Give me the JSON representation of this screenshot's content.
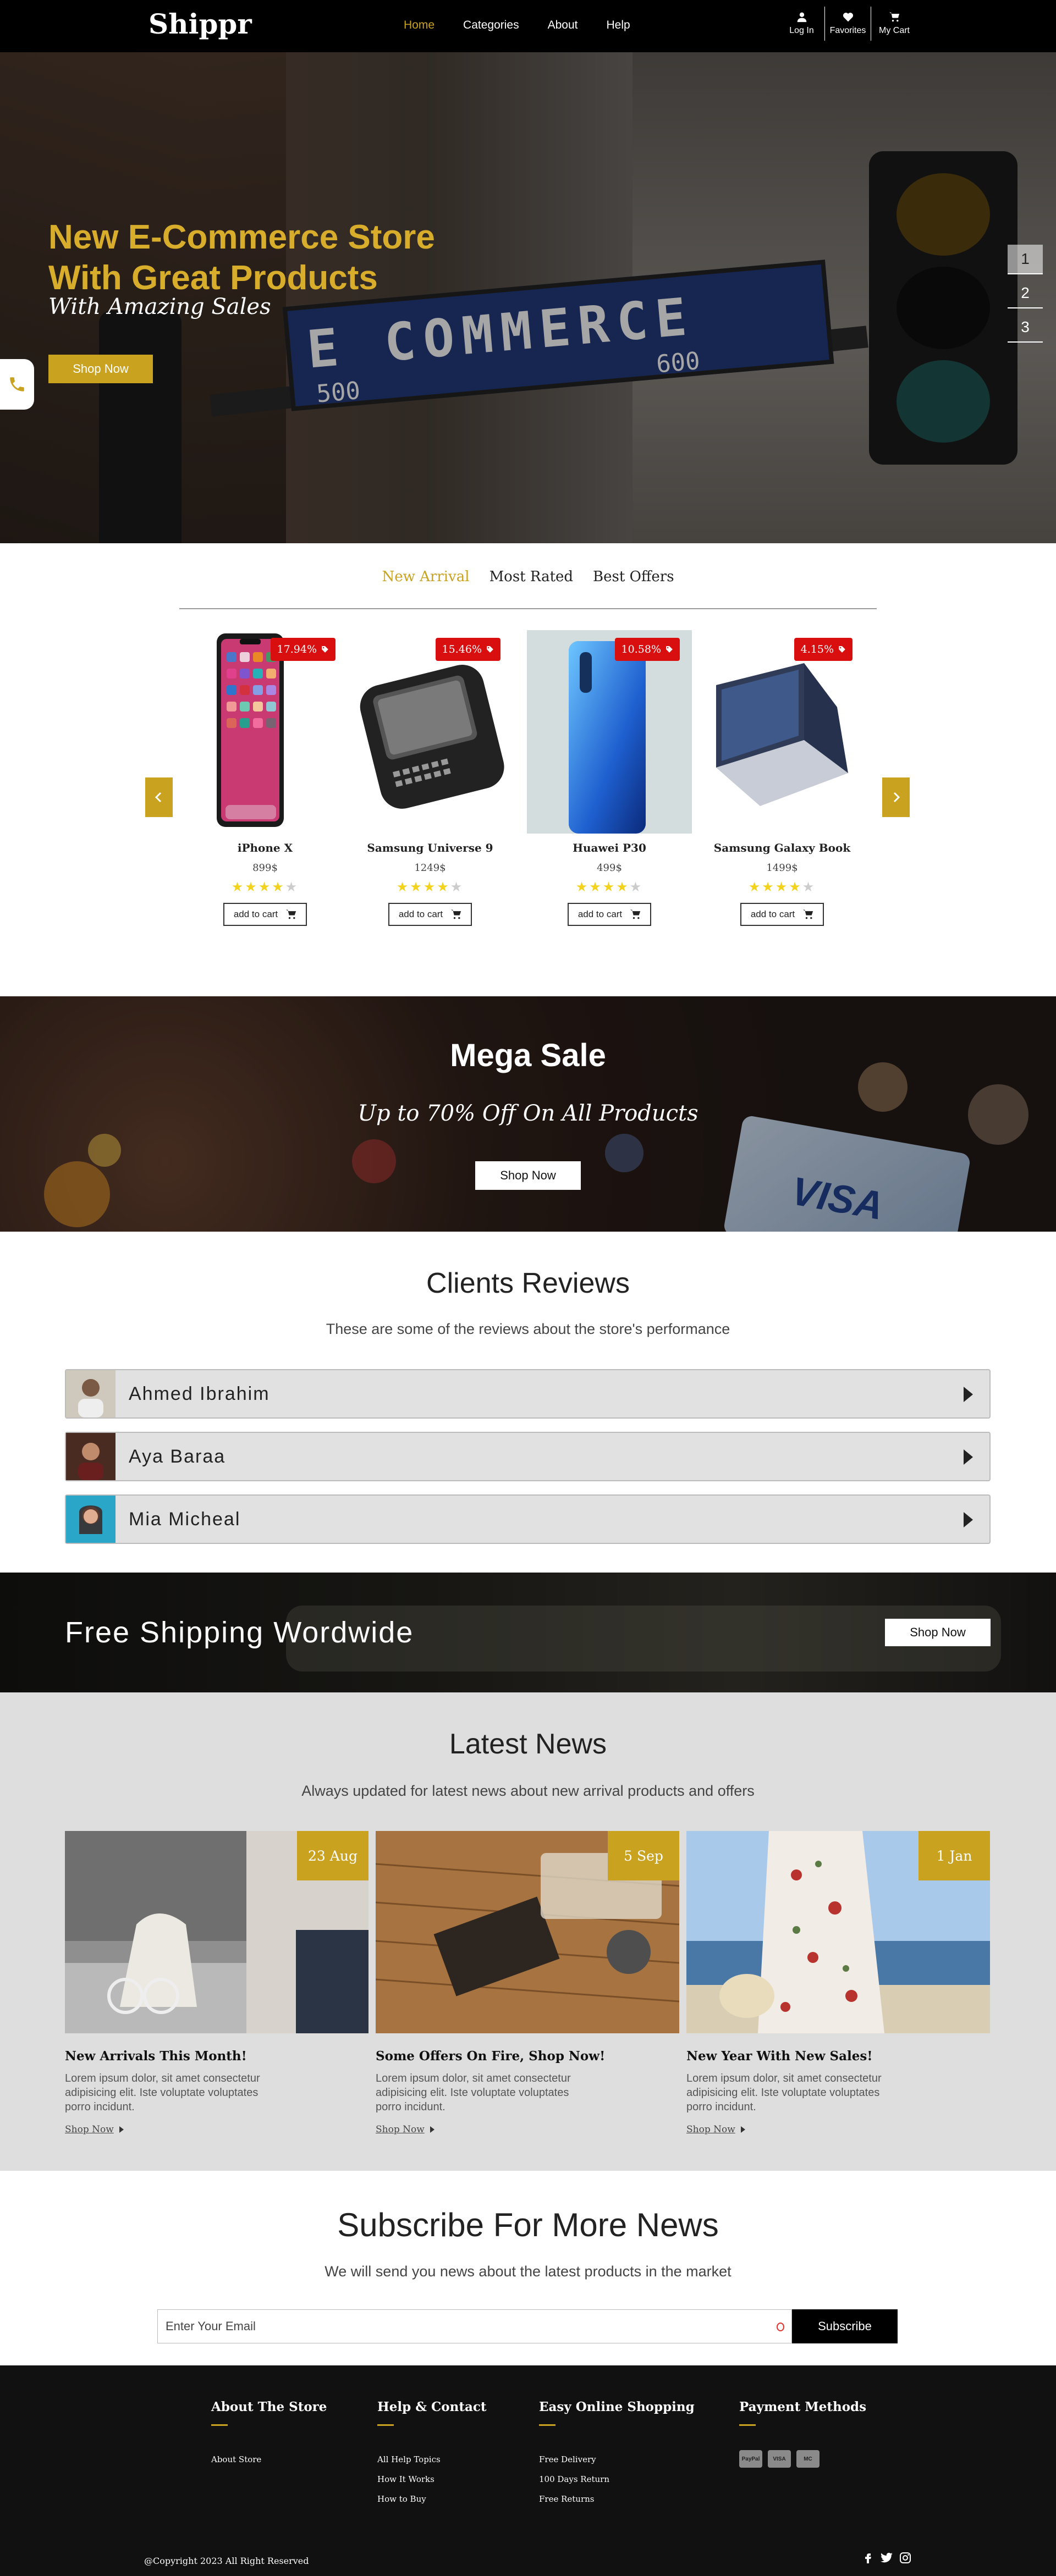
{
  "brand": "Shippr",
  "nav": {
    "links": [
      {
        "label": "Home",
        "active": true
      },
      {
        "label": "Categories",
        "active": false
      },
      {
        "label": "About",
        "active": false
      },
      {
        "label": "Help",
        "active": false
      }
    ],
    "icons": [
      {
        "label": "Log In",
        "icon": "user-icon"
      },
      {
        "label": "Favorites",
        "icon": "heart-icon"
      },
      {
        "label": "My Cart",
        "icon": "cart-icon"
      }
    ]
  },
  "hero": {
    "title_line1": "New E-Commerce Store",
    "title_line2": "With Great Products",
    "subtitle": "With Amazing Sales",
    "button": "Shop Now",
    "sign_text": "E COMMERCE",
    "sign_num1": "500",
    "sign_num2": "600",
    "slides": [
      "1",
      "2",
      "3"
    ],
    "active_slide": 1
  },
  "products": {
    "tabs": [
      "New Arrival",
      "Most Rated",
      "Best Offers"
    ],
    "active_tab": 0,
    "items": [
      {
        "name": "iPhone X",
        "price": "899$",
        "discount": "17.94%",
        "rating": 4,
        "add_label": "add to cart"
      },
      {
        "name": "Samsung Universe 9",
        "price": "1249$",
        "discount": "15.46%",
        "rating": 4,
        "add_label": "add to cart"
      },
      {
        "name": "Huawei P30",
        "price": "499$",
        "discount": "10.58%",
        "rating": 4,
        "add_label": "add to cart"
      },
      {
        "name": "Samsung Galaxy Book",
        "price": "1499$",
        "discount": "4.15%",
        "rating": 4,
        "add_label": "add to cart"
      }
    ]
  },
  "mega": {
    "title": "Mega Sale",
    "subtitle": "Up to 70% Off On All Products",
    "button": "Shop Now",
    "card_text": "VISA"
  },
  "reviews": {
    "title": "Clients Reviews",
    "subtitle": "These are some of the reviews about the store's performance",
    "items": [
      {
        "name": "Ahmed Ibrahim"
      },
      {
        "name": "Aya Baraa"
      },
      {
        "name": "Mia Micheal"
      }
    ]
  },
  "shipping": {
    "title": "Free Shipping Wordwide",
    "button": "Shop Now"
  },
  "news": {
    "title": "Latest News",
    "subtitle": "Always updated for latest news about new arrival products and offers",
    "items": [
      {
        "date": "23 Aug",
        "title": "New Arrivals This Month!",
        "desc": "Lorem ipsum dolor, sit amet consectetur adipisicing elit. Iste voluptate voluptates porro incidunt.",
        "more": "Shop Now"
      },
      {
        "date": "5 Sep",
        "title": "Some Offers On Fire, Shop Now!",
        "desc": "Lorem ipsum dolor, sit amet consectetur adipisicing elit. Iste voluptate voluptates porro incidunt.",
        "more": "Shop Now"
      },
      {
        "date": "1 Jan",
        "title": "New Year With New Sales!",
        "desc": "Lorem ipsum dolor, sit amet consectetur adipisicing elit. Iste voluptate voluptates porro incidunt.",
        "more": "Shop Now"
      }
    ]
  },
  "subscribe": {
    "title": "Subscribe For More News",
    "subtitle": "We will send you news about the latest products in the market",
    "placeholder": "Enter Your Email",
    "button": "Subscribe"
  },
  "footer": {
    "columns": [
      {
        "title": "About The Store",
        "links": [
          "About Store"
        ]
      },
      {
        "title": "Help & Contact",
        "links": [
          "All Help Topics",
          "How It Works",
          "How to Buy"
        ]
      },
      {
        "title": "Easy Online Shopping",
        "links": [
          "Free Delivery",
          "100 Days Return",
          "Free Returns"
        ]
      },
      {
        "title": "Payment Methods",
        "links": []
      }
    ],
    "payment_icons": [
      "PayPal",
      "VISA",
      "MC"
    ],
    "copyright": "@Copyright 2023 All Right Reserved",
    "socials": [
      "facebook-icon",
      "twitter-icon",
      "instagram-icon"
    ]
  },
  "colors": {
    "accent": "#c9a21f",
    "badge": "#d90e0e",
    "navbar": "#000000",
    "footer": "#111111",
    "news_bg": "#dedede"
  }
}
